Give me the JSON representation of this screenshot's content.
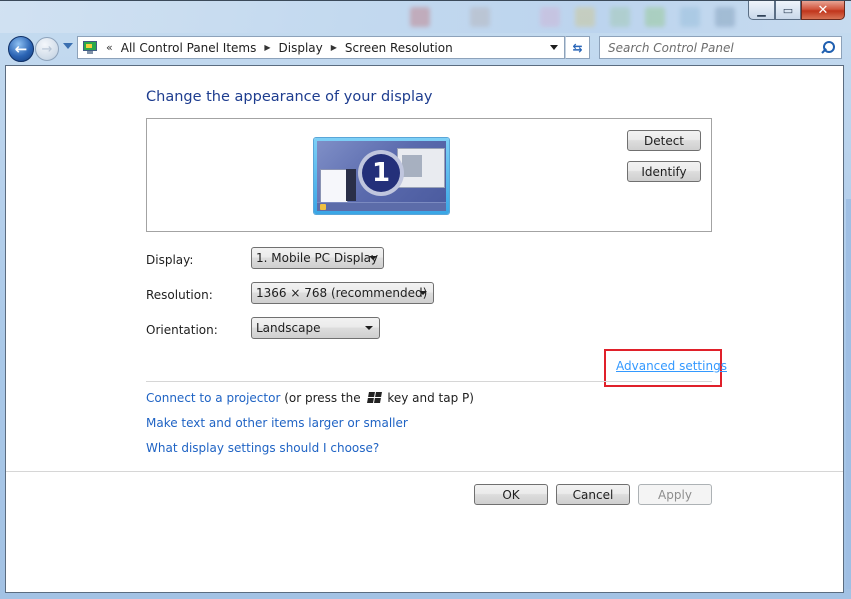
{
  "window": {
    "controls": {
      "minimize": "minimize",
      "maximize": "maximize",
      "close": "close"
    }
  },
  "navigation": {
    "back_icon": "back-arrow-icon",
    "forward_icon": "forward-arrow-icon",
    "overflow": "«",
    "breadcrumbs": [
      "All Control Panel Items",
      "Display",
      "Screen Resolution"
    ],
    "search_placeholder": "Search Control Panel"
  },
  "main": {
    "heading": "Change the appearance of your display",
    "monitor_number": "1",
    "detect_label": "Detect",
    "identify_label": "Identify",
    "fields": {
      "display": {
        "label": "Display:",
        "value": "1. Mobile PC Display"
      },
      "resolution": {
        "label": "Resolution:",
        "value": "1366 × 768 (recommended)"
      },
      "orientation": {
        "label": "Orientation:",
        "value": "Landscape"
      }
    },
    "advanced_settings": "Advanced settings",
    "highlight_color": "#e0202a",
    "links": {
      "projector": "Connect to a projector",
      "projector_hint_pre": "(or press the",
      "projector_hint_post": "key and tap P)",
      "text_size": "Make text and other items larger or smaller",
      "help": "What display settings should I choose?"
    }
  },
  "footer": {
    "ok": "OK",
    "cancel": "Cancel",
    "apply": "Apply"
  }
}
